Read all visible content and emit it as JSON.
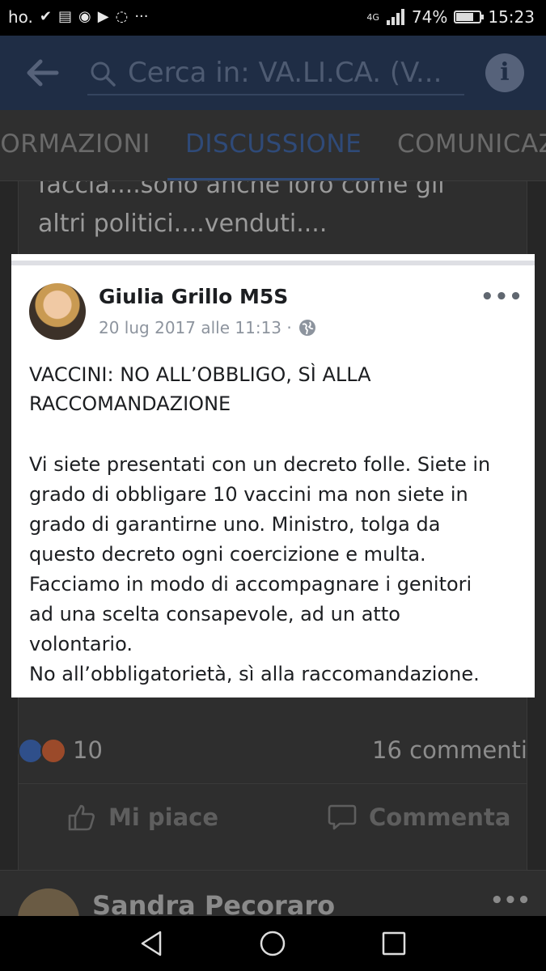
{
  "status_bar": {
    "carrier": "ho.",
    "network": "4G",
    "battery": "74%",
    "battery_level": 0.74,
    "time": "15:23"
  },
  "app_bar": {
    "search_placeholder": "Cerca in: VA.LI.CA. (V..."
  },
  "tabs": [
    {
      "label": "FORMAZIONI"
    },
    {
      "label": "DISCUSSIONE",
      "active": true
    },
    {
      "label": "COMUNICAZIONI"
    }
  ],
  "post": {
    "text_lines": [
      "faccia....sono anche loro come gli",
      "altri politici....venduti...."
    ],
    "embedded_screenshot": {
      "author": "Giulia Grillo M5S",
      "date": "20 lug 2017 alle 11:13 ·",
      "title_lines": [
        "VACCINI: NO ALL’OBBLIGO, SÌ ALLA",
        "RACCOMANDAZIONE"
      ],
      "body_lines": [
        "Vi siete presentati con un decreto folle. Siete in",
        "grado di obbligare 10 vaccini ma non siete in",
        "grado di garantirne uno. Ministro, tolga da",
        "questo decreto ogni coercizione e multa.",
        "Facciamo in modo di accompagnare i genitori",
        "ad una scelta consapevole, ad un atto",
        "volontario.",
        "No all’obbligatorietà, sì alla raccomandazione."
      ]
    },
    "reactions_count": "10",
    "comments_count": "16 commenti",
    "like_label": "Mi piace",
    "comment_label": "Commenta"
  },
  "next_post": {
    "author": "Sandra Pecoraro"
  },
  "colors": {
    "app_bar": "#1f2d45",
    "active_tab": "#2f4a78",
    "background": "#262626"
  }
}
